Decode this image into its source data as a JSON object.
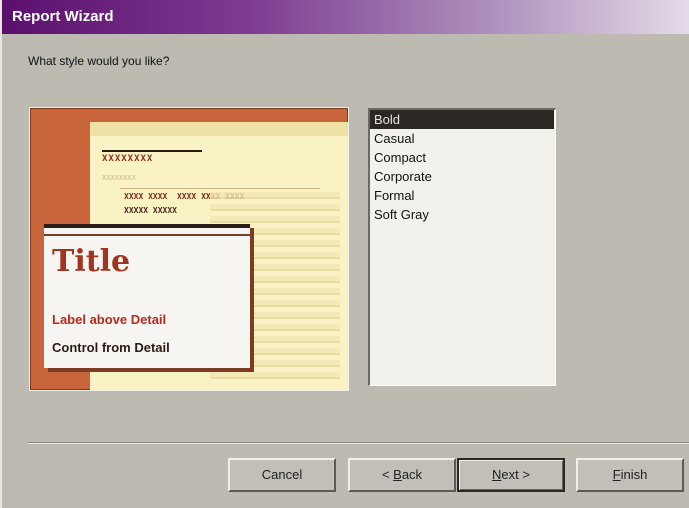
{
  "window": {
    "title": "Report Wizard"
  },
  "prompt": "What style would you like?",
  "preview": {
    "header_text": "XXXXXXXX",
    "sub_text": "XXXXXXXX",
    "group_header_1": "XXXX XXXX  XXXX XXXX XXXX",
    "group_header_2": "XXXXX XXXXX",
    "title": "Title",
    "label_text": "Label above Detail",
    "control_text": "Control from Detail"
  },
  "styles": {
    "selected": "Bold",
    "items": [
      "Bold",
      "Casual",
      "Compact",
      "Corporate",
      "Formal",
      "Soft Gray"
    ]
  },
  "buttons": {
    "cancel": "Cancel",
    "back_pre": "< ",
    "back_key": "B",
    "back_post": "ack",
    "next_key": "N",
    "next_post": "ext >",
    "finish_key": "F",
    "finish_post": "inish"
  },
  "colors": {
    "title_gradient_start": "#5b0f6d",
    "preview_accent": "#c8653a",
    "preview_title": "#a2341f",
    "selection": "#2b2723"
  }
}
